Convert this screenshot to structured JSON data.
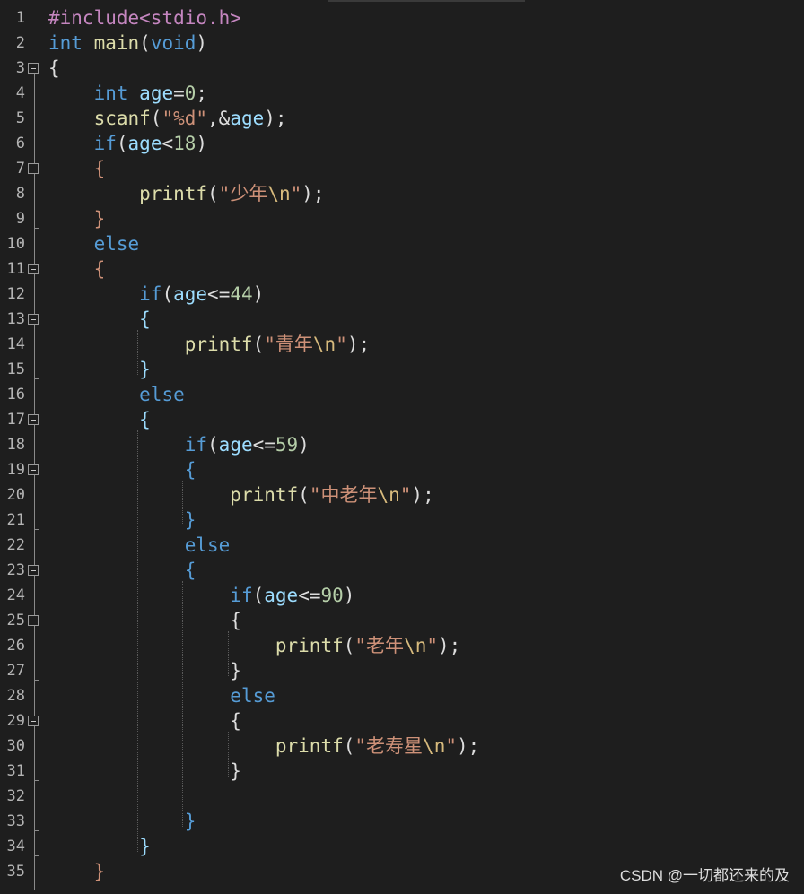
{
  "editor": {
    "lines": [
      {
        "n": "1",
        "tokens": [
          [
            "#include",
            "tok-pp"
          ],
          [
            "<stdio.h>",
            "tok-pp"
          ]
        ]
      },
      {
        "n": "2",
        "tokens": [
          [
            "int",
            "tok-kw"
          ],
          [
            " ",
            "tok-punc"
          ],
          [
            "main",
            "tok-fn"
          ],
          [
            "(",
            "tok-punc"
          ],
          [
            "void",
            "tok-kw"
          ],
          [
            ")",
            "tok-punc"
          ]
        ]
      },
      {
        "n": "3",
        "tokens": [
          [
            "{",
            "tok-punc"
          ]
        ]
      },
      {
        "n": "4",
        "tokens": [
          [
            "    ",
            "tok-punc"
          ],
          [
            "int",
            "tok-kw"
          ],
          [
            " ",
            "tok-punc"
          ],
          [
            "age",
            "tok-var"
          ],
          [
            "=",
            "tok-punc"
          ],
          [
            "0",
            "tok-num"
          ],
          [
            ";",
            "tok-punc"
          ]
        ]
      },
      {
        "n": "5",
        "tokens": [
          [
            "    ",
            "tok-punc"
          ],
          [
            "scanf",
            "tok-fn"
          ],
          [
            "(",
            "tok-punc"
          ],
          [
            "\"%d\"",
            "tok-str"
          ],
          [
            ",&",
            "tok-punc"
          ],
          [
            "age",
            "tok-var"
          ],
          [
            ");",
            "tok-punc"
          ]
        ]
      },
      {
        "n": "6",
        "tokens": [
          [
            "    ",
            "tok-punc"
          ],
          [
            "if",
            "tok-kw"
          ],
          [
            "(",
            "tok-punc"
          ],
          [
            "age",
            "tok-var"
          ],
          [
            "<",
            "tok-punc"
          ],
          [
            "18",
            "tok-num"
          ],
          [
            ")",
            "tok-punc"
          ]
        ]
      },
      {
        "n": "7",
        "tokens": [
          [
            "    ",
            "tok-punc"
          ],
          [
            "{",
            "tok-str"
          ]
        ]
      },
      {
        "n": "8",
        "tokens": [
          [
            "        ",
            "tok-punc"
          ],
          [
            "printf",
            "tok-fn"
          ],
          [
            "(",
            "tok-punc"
          ],
          [
            "\"少年",
            "tok-str"
          ],
          [
            "\\n",
            "tok-esc"
          ],
          [
            "\"",
            "tok-str"
          ],
          [
            ");",
            "tok-punc"
          ]
        ]
      },
      {
        "n": "9",
        "tokens": [
          [
            "    ",
            "tok-punc"
          ],
          [
            "}",
            "tok-str"
          ]
        ]
      },
      {
        "n": "10",
        "tokens": [
          [
            "    ",
            "tok-punc"
          ],
          [
            "else",
            "tok-kw"
          ]
        ]
      },
      {
        "n": "11",
        "tokens": [
          [
            "    ",
            "tok-punc"
          ],
          [
            "{",
            "tok-str"
          ]
        ]
      },
      {
        "n": "12",
        "tokens": [
          [
            "        ",
            "tok-punc"
          ],
          [
            "if",
            "tok-kw"
          ],
          [
            "(",
            "tok-punc"
          ],
          [
            "age",
            "tok-var"
          ],
          [
            "<=",
            "tok-punc"
          ],
          [
            "44",
            "tok-num"
          ],
          [
            ")",
            "tok-punc"
          ]
        ]
      },
      {
        "n": "13",
        "tokens": [
          [
            "        ",
            "tok-punc"
          ],
          [
            "{",
            "tok-var"
          ]
        ]
      },
      {
        "n": "14",
        "tokens": [
          [
            "            ",
            "tok-punc"
          ],
          [
            "printf",
            "tok-fn"
          ],
          [
            "(",
            "tok-punc"
          ],
          [
            "\"青年",
            "tok-str"
          ],
          [
            "\\n",
            "tok-esc"
          ],
          [
            "\"",
            "tok-str"
          ],
          [
            ");",
            "tok-punc"
          ]
        ]
      },
      {
        "n": "15",
        "tokens": [
          [
            "        ",
            "tok-punc"
          ],
          [
            "}",
            "tok-var"
          ]
        ]
      },
      {
        "n": "16",
        "tokens": [
          [
            "        ",
            "tok-punc"
          ],
          [
            "else",
            "tok-kw"
          ]
        ]
      },
      {
        "n": "17",
        "tokens": [
          [
            "        ",
            "tok-punc"
          ],
          [
            "{",
            "tok-var"
          ]
        ]
      },
      {
        "n": "18",
        "tokens": [
          [
            "            ",
            "tok-punc"
          ],
          [
            "if",
            "tok-kw"
          ],
          [
            "(",
            "tok-punc"
          ],
          [
            "age",
            "tok-var"
          ],
          [
            "<=",
            "tok-punc"
          ],
          [
            "59",
            "tok-num"
          ],
          [
            ")",
            "tok-punc"
          ]
        ]
      },
      {
        "n": "19",
        "tokens": [
          [
            "            ",
            "tok-punc"
          ],
          [
            "{",
            "tok-kw"
          ]
        ]
      },
      {
        "n": "20",
        "tokens": [
          [
            "                ",
            "tok-punc"
          ],
          [
            "printf",
            "tok-fn"
          ],
          [
            "(",
            "tok-punc"
          ],
          [
            "\"中老年",
            "tok-str"
          ],
          [
            "\\n",
            "tok-esc"
          ],
          [
            "\"",
            "tok-str"
          ],
          [
            ");",
            "tok-punc"
          ]
        ]
      },
      {
        "n": "21",
        "tokens": [
          [
            "            ",
            "tok-punc"
          ],
          [
            "}",
            "tok-kw"
          ]
        ]
      },
      {
        "n": "22",
        "tokens": [
          [
            "            ",
            "tok-punc"
          ],
          [
            "else",
            "tok-kw"
          ]
        ]
      },
      {
        "n": "23",
        "tokens": [
          [
            "            ",
            "tok-punc"
          ],
          [
            "{",
            "tok-kw"
          ]
        ]
      },
      {
        "n": "24",
        "tokens": [
          [
            "                ",
            "tok-punc"
          ],
          [
            "if",
            "tok-kw"
          ],
          [
            "(",
            "tok-punc"
          ],
          [
            "age",
            "tok-var"
          ],
          [
            "<=",
            "tok-punc"
          ],
          [
            "90",
            "tok-num"
          ],
          [
            ")",
            "tok-punc"
          ]
        ]
      },
      {
        "n": "25",
        "tokens": [
          [
            "                ",
            "tok-punc"
          ],
          [
            "{",
            "tok-punc"
          ]
        ]
      },
      {
        "n": "26",
        "tokens": [
          [
            "                    ",
            "tok-punc"
          ],
          [
            "printf",
            "tok-fn"
          ],
          [
            "(",
            "tok-punc"
          ],
          [
            "\"老年",
            "tok-str"
          ],
          [
            "\\n",
            "tok-esc"
          ],
          [
            "\"",
            "tok-str"
          ],
          [
            ");",
            "tok-punc"
          ]
        ]
      },
      {
        "n": "27",
        "tokens": [
          [
            "                ",
            "tok-punc"
          ],
          [
            "}",
            "tok-punc"
          ]
        ]
      },
      {
        "n": "28",
        "tokens": [
          [
            "                ",
            "tok-punc"
          ],
          [
            "else",
            "tok-kw"
          ]
        ]
      },
      {
        "n": "29",
        "tokens": [
          [
            "                ",
            "tok-punc"
          ],
          [
            "{",
            "tok-punc"
          ]
        ]
      },
      {
        "n": "30",
        "tokens": [
          [
            "                    ",
            "tok-punc"
          ],
          [
            "printf",
            "tok-fn"
          ],
          [
            "(",
            "tok-punc"
          ],
          [
            "\"老寿星",
            "tok-str"
          ],
          [
            "\\n",
            "tok-esc"
          ],
          [
            "\"",
            "tok-str"
          ],
          [
            ");",
            "tok-punc"
          ]
        ]
      },
      {
        "n": "31",
        "tokens": [
          [
            "                ",
            "tok-punc"
          ],
          [
            "}",
            "tok-punc"
          ]
        ]
      },
      {
        "n": "32",
        "tokens": []
      },
      {
        "n": "33",
        "tokens": [
          [
            "            ",
            "tok-punc"
          ],
          [
            "}",
            "tok-kw"
          ]
        ]
      },
      {
        "n": "34",
        "tokens": [
          [
            "        ",
            "tok-punc"
          ],
          [
            "}",
            "tok-var"
          ]
        ]
      },
      {
        "n": "35",
        "tokens": [
          [
            "    ",
            "tok-punc"
          ],
          [
            "}",
            "tok-str"
          ]
        ]
      }
    ],
    "fold_markers": [
      3,
      7,
      11,
      13,
      17,
      19,
      23,
      25,
      29
    ]
  },
  "watermark": "CSDN @一切都还来的及",
  "colors": {
    "background": "#1e1e1e",
    "keyword": "#569cd6",
    "function": "#dcdcaa",
    "variable": "#9cdcfe",
    "string": "#ce9178",
    "number": "#b5cea8",
    "preprocessor": "#c586c0",
    "escape": "#d7ba7d"
  }
}
